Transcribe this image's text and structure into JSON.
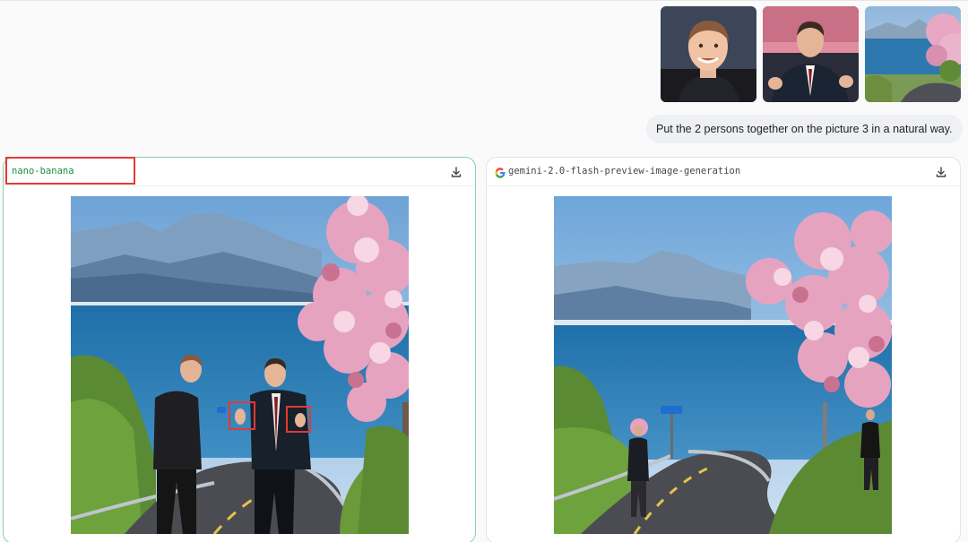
{
  "conversation": {
    "attachments": [
      {
        "name": "person-1-portrait",
        "kind": "image"
      },
      {
        "name": "person-2-portrait",
        "kind": "image"
      },
      {
        "name": "coastal-road-scene",
        "kind": "image"
      }
    ],
    "prompt": "Put the 2 persons together on the picture 3 in a natural way."
  },
  "panels": {
    "left": {
      "model": "nano-banana",
      "icon": "download-icon"
    },
    "right": {
      "model": "gemini-2.0-flash-preview-image-generation",
      "icon": "download-icon",
      "logo": "google-g-icon"
    }
  },
  "colors": {
    "accent_green": "#1e8e3e",
    "panel_border_green": "#86d2ad",
    "annotation_red": "#e53935",
    "bubble_bg": "#eef0f3"
  }
}
